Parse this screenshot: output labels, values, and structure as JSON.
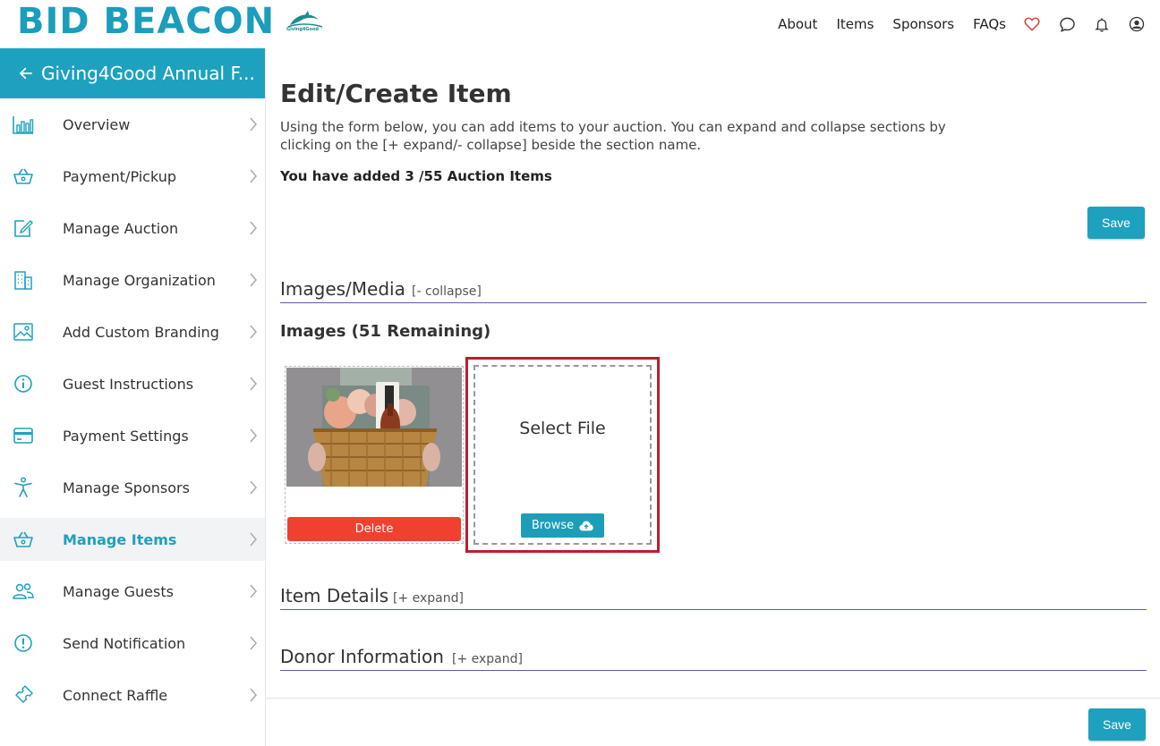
{
  "header": {
    "logo_text": "BID BEACON",
    "org_logo_text": "Giving4Good",
    "nav": {
      "about": "About",
      "items": "Items",
      "sponsors": "Sponsors",
      "faqs": "FAQs"
    }
  },
  "sidebar": {
    "title": "Giving4Good Annual F...",
    "items": [
      {
        "label": "Overview",
        "icon": "bar-chart-icon"
      },
      {
        "label": "Payment/Pickup",
        "icon": "basket-icon"
      },
      {
        "label": "Manage Auction",
        "icon": "edit-icon"
      },
      {
        "label": "Manage Organization",
        "icon": "building-icon"
      },
      {
        "label": "Add Custom Branding",
        "icon": "image-icon"
      },
      {
        "label": "Guest Instructions",
        "icon": "info-icon"
      },
      {
        "label": "Payment Settings",
        "icon": "credit-card-icon"
      },
      {
        "label": "Manage Sponsors",
        "icon": "person-icon"
      },
      {
        "label": "Manage Items",
        "icon": "basket-icon",
        "active": true
      },
      {
        "label": "Manage Guests",
        "icon": "users-icon"
      },
      {
        "label": "Send Notification",
        "icon": "alert-icon"
      },
      {
        "label": "Connect Raffle",
        "icon": "ticket-icon"
      }
    ]
  },
  "main": {
    "title": "Edit/Create Item",
    "description": "Using the form below, you can add items to your auction. You can expand and collapse sections by clicking on the [+ expand/- collapse] beside the section name.",
    "added_text": "You have added 3 /55 Auction Items",
    "save_label": "Save",
    "sections": {
      "images_media": {
        "title": "Images/Media",
        "toggle": "[- collapse]"
      },
      "item_details": {
        "title": "Item Details",
        "toggle": "[+ expand]"
      },
      "donor_information": {
        "title": "Donor Information",
        "toggle": "[+ expand]"
      }
    },
    "images_label": "Images (51 Remaining)",
    "delete_label": "Delete",
    "select_file_label": "Select File",
    "browse_label": "Browse"
  },
  "colors": {
    "brand": "#1ea1bf",
    "delete": "#f04030",
    "highlight": "#b81f2e",
    "section_line": "#5a5ea8"
  }
}
